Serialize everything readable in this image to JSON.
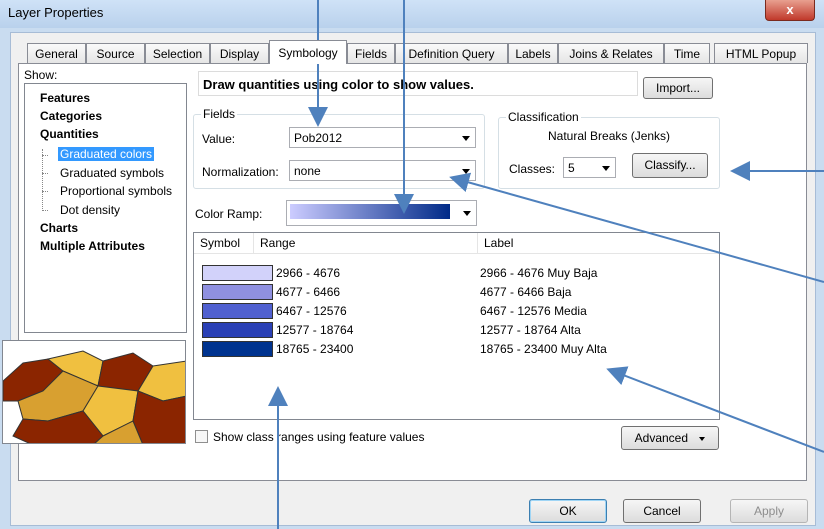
{
  "window": {
    "title": "Layer Properties",
    "close_glyph": "x"
  },
  "tabs": [
    "General",
    "Source",
    "Selection",
    "Display",
    "Symbology",
    "Fields",
    "Definition Query",
    "Labels",
    "Joins & Relates",
    "Time",
    "HTML Popup"
  ],
  "active_tab": "Symbology",
  "show": {
    "label": "Show:",
    "categories": [
      "Features",
      "Categories",
      "Quantities"
    ],
    "subitems": [
      "Graduated colors",
      "Graduated symbols",
      "Proportional symbols",
      "Dot density"
    ],
    "categories_after": [
      "Charts",
      "Multiple Attributes"
    ],
    "selected": "Graduated colors"
  },
  "heading": "Draw quantities using color to show values.",
  "import_button": "Import...",
  "fields": {
    "title": "Fields",
    "value_label": "Value:",
    "value": "Pob2012",
    "normalization_label": "Normalization:",
    "normalization": "none"
  },
  "classification": {
    "title": "Classification",
    "method": "Natural Breaks (Jenks)",
    "classes_label": "Classes:",
    "classes": "5",
    "classify_button": "Classify..."
  },
  "color_ramp": {
    "label": "Color Ramp:",
    "start_color": "#ccccff",
    "end_color": "#002a88"
  },
  "table": {
    "headers": [
      "Symbol",
      "Range",
      "Label"
    ],
    "rows": [
      {
        "color": "#d2d2fa",
        "range": "2966 - 4676",
        "label": "2966 - 4676 Muy Baja"
      },
      {
        "color": "#8f90e0",
        "range": "4677 - 6466",
        "label": "4677 - 6466 Baja"
      },
      {
        "color": "#5060d0",
        "range": "6467 - 12576",
        "label": "6467 - 12576 Media"
      },
      {
        "color": "#2a40b5",
        "range": "12577 - 18764",
        "label": "12577 - 18764 Alta"
      },
      {
        "color": "#00338f",
        "range": "18765 - 23400",
        "label": "18765 - 23400 Muy Alta"
      }
    ]
  },
  "show_class_ranges": "Show class ranges using feature values",
  "advanced_button": "Advanced",
  "footer": {
    "ok": "OK",
    "cancel": "Cancel",
    "apply": "Apply"
  },
  "icons": [
    "close-icon",
    "dropdown-arrow-icon",
    "map-preview-image"
  ]
}
